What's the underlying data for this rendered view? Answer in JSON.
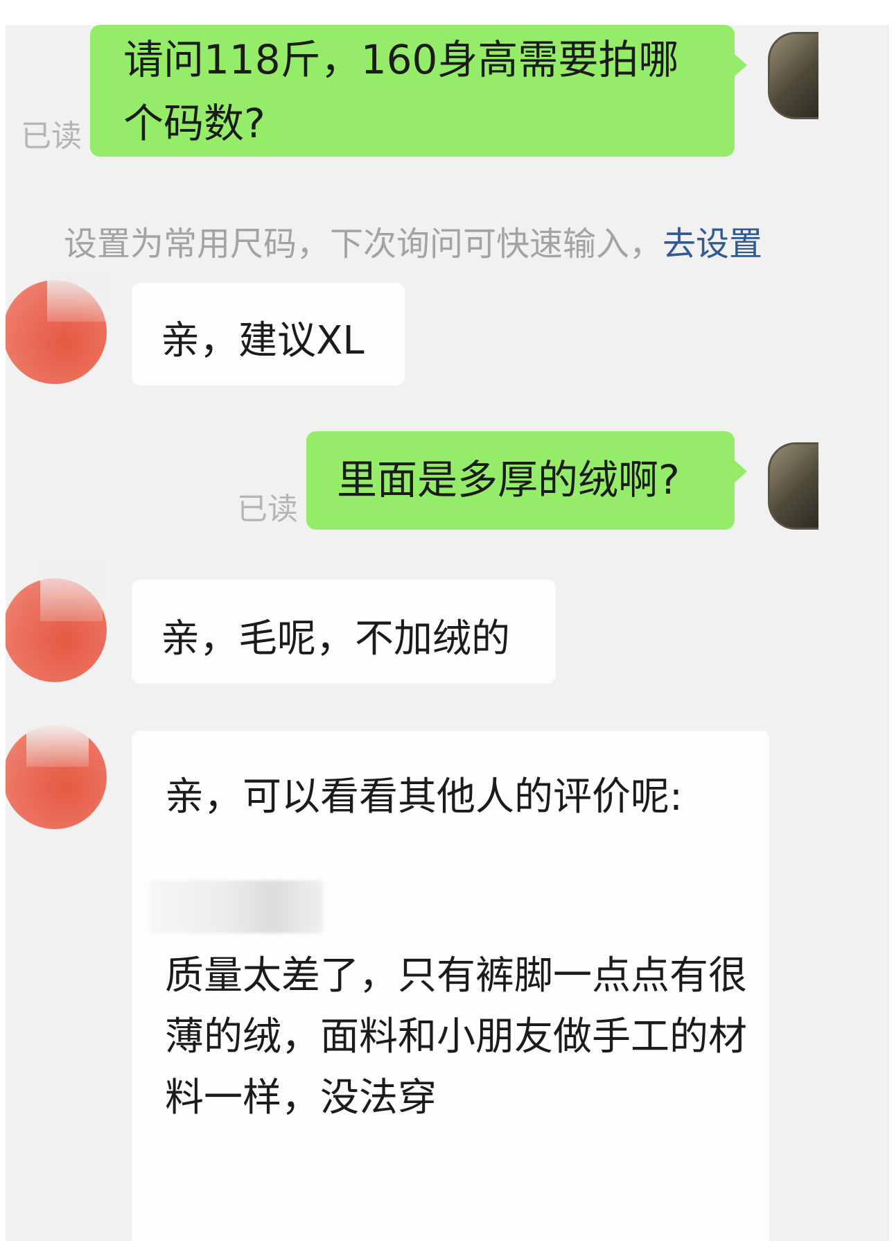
{
  "messages": [
    {
      "id": 1,
      "sender": "me",
      "text": "请问118斤，160身高需要拍哪个码数?",
      "status": "已读"
    },
    {
      "id": 2,
      "sender": "system_tip",
      "text": "设置为常用尺码，下次询问可快速输入，",
      "link": "去设置"
    },
    {
      "id": 3,
      "sender": "shop",
      "text": "亲，建议XL"
    },
    {
      "id": 4,
      "sender": "me",
      "text": "里面是多厚的绒啊?",
      "status": "已读"
    },
    {
      "id": 5,
      "sender": "shop",
      "text": "亲，毛呢，不加绒的"
    },
    {
      "id": 6,
      "sender": "shop",
      "text": "亲，可以看看其他人的评价呢:",
      "review": {
        "text": "质量太差了，只有裤脚一点点有很薄的绒，面料和小朋友做手工的材料一样，没法穿"
      }
    }
  ],
  "colors": {
    "outgoing_bubble": "#95ec69",
    "incoming_bubble": "#fdfdfd",
    "chat_background": "#f1f1f1",
    "link": "#2f5a93",
    "read_receipt": "#b5b5b5"
  },
  "icons": {
    "self_avatar": "user-avatar-icon",
    "shop_avatar": "shop-avatar-icon"
  }
}
